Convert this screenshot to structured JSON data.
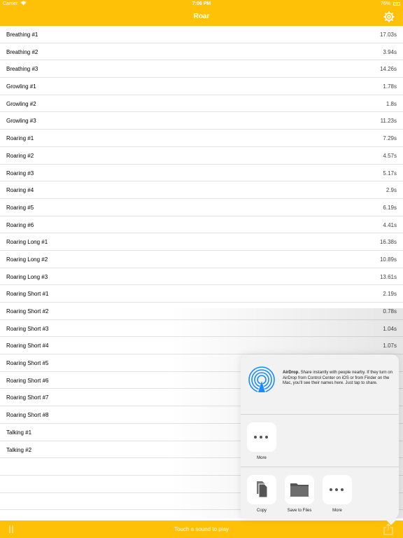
{
  "status_bar": {
    "carrier": "Carrier",
    "time": "7:06 PM",
    "battery": "76%"
  },
  "nav": {
    "title": "Roar",
    "settings_icon": "gear-icon"
  },
  "sounds": [
    {
      "name": "Breathing #1",
      "duration": "17.03s"
    },
    {
      "name": "Breathing #2",
      "duration": "3.94s"
    },
    {
      "name": "Breathing #3",
      "duration": "14.26s"
    },
    {
      "name": "Growling #1",
      "duration": "1.78s"
    },
    {
      "name": "Growling #2",
      "duration": "1.8s"
    },
    {
      "name": "Growling #3",
      "duration": "11.23s"
    },
    {
      "name": "Roaring #1",
      "duration": "7.29s"
    },
    {
      "name": "Roaring #2",
      "duration": "4.57s"
    },
    {
      "name": "Roaring #3",
      "duration": "5.17s"
    },
    {
      "name": "Roaring #4",
      "duration": "2.9s"
    },
    {
      "name": "Roaring #5",
      "duration": "6.19s"
    },
    {
      "name": "Roaring #6",
      "duration": "4.41s"
    },
    {
      "name": "Roaring Long #1",
      "duration": "16.38s"
    },
    {
      "name": "Roaring Long #2",
      "duration": "10.89s"
    },
    {
      "name": "Roaring Long #3",
      "duration": "13.61s"
    },
    {
      "name": "Roaring Short #1",
      "duration": "2.19s"
    },
    {
      "name": "Roaring Short #2",
      "duration": "0.78s"
    },
    {
      "name": "Roaring Short #3",
      "duration": "1.04s"
    },
    {
      "name": "Roaring Short #4",
      "duration": "1.07s"
    },
    {
      "name": "Roaring Short #5",
      "duration": ""
    },
    {
      "name": "Roaring Short #6",
      "duration": ""
    },
    {
      "name": "Roaring Short #7",
      "duration": ""
    },
    {
      "name": "Roaring Short #8",
      "duration": ""
    },
    {
      "name": "Talking #1",
      "duration": ""
    },
    {
      "name": "Talking #2",
      "duration": ""
    }
  ],
  "bottom_bar": {
    "hint": "Touch a sound to play",
    "pause_icon": "pause-icon",
    "share_icon": "share-icon"
  },
  "share_sheet": {
    "airdrop_title": "AirDrop.",
    "airdrop_text": "Share instantly with people nearby. If they turn on AirDrop from Control Center on iOS or from Finder on the Mac, you'll see their names here. Just tap to share.",
    "apps": [
      {
        "label": "More",
        "icon": "more-icon"
      }
    ],
    "actions": [
      {
        "label": "Copy",
        "icon": "copy-icon"
      },
      {
        "label": "Save to Files",
        "icon": "folder-icon"
      },
      {
        "label": "More",
        "icon": "more-icon"
      }
    ]
  },
  "colors": {
    "accent": "#ffc107",
    "airdrop": "#1a8cff"
  }
}
